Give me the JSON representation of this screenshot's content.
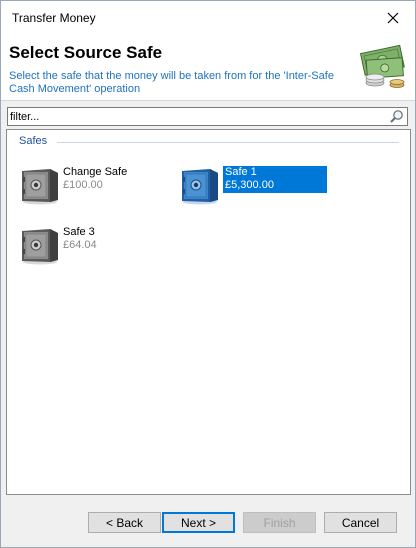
{
  "window": {
    "title": "Transfer Money"
  },
  "header": {
    "title": "Select Source Safe",
    "description": "Select the safe that the money will be taken from for the 'Inter-Safe Cash Movement' operation",
    "image_icon": "money-icon"
  },
  "filter": {
    "placeholder": "filter...",
    "value": ""
  },
  "list": {
    "group_label": "Safes",
    "items": [
      {
        "name": "Change Safe",
        "amount": "£100.00",
        "selected": false
      },
      {
        "name": "Safe 1",
        "amount": "£5,300.00",
        "selected": true
      },
      {
        "name": "Safe 3",
        "amount": "£64.04",
        "selected": false
      }
    ]
  },
  "buttons": {
    "back": "< Back",
    "next": "Next >",
    "finish": "Finish",
    "cancel": "Cancel"
  },
  "colors": {
    "accent": "#0078d7",
    "header_desc": "#1e73be",
    "selected_safe": "#3d84c9",
    "default_safe": "#7a7a7a"
  }
}
